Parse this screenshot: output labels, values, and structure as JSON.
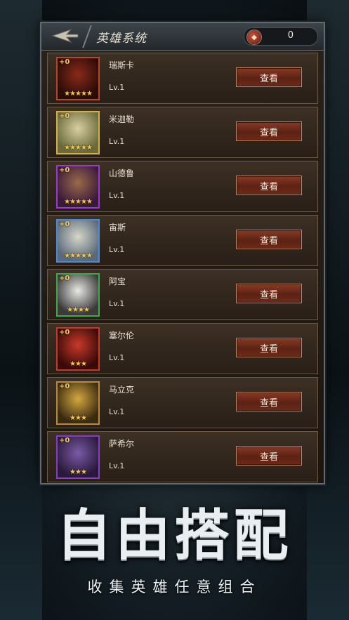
{
  "header": {
    "title": "英雄系统",
    "currency_value": "0"
  },
  "heroes": [
    {
      "name": "瑞斯卡",
      "plus": "+0",
      "level": "Lv.1",
      "stars": "★★★★★",
      "view_label": "查看",
      "border": "#b8452a",
      "face": [
        "#8a2a1a",
        "#2a0c07"
      ]
    },
    {
      "name": "米迦勒",
      "plus": "+0",
      "level": "Lv.1",
      "stars": "★★★★★",
      "view_label": "查看",
      "border": "#d4b04a",
      "face": [
        "#d8cfa2",
        "#6a6a3a"
      ]
    },
    {
      "name": "山德鲁",
      "plus": "+0",
      "level": "Lv.1",
      "stars": "★★★★★",
      "view_label": "查看",
      "border": "#9a3ad0",
      "face": [
        "#9a6a4a",
        "#3a1a3a"
      ]
    },
    {
      "name": "宙斯",
      "plus": "+0",
      "level": "Lv.1",
      "stars": "★★★★★",
      "view_label": "查看",
      "border": "#4a8ad8",
      "face": [
        "#d8d6c8",
        "#5a6a7a"
      ]
    },
    {
      "name": "阿宝",
      "plus": "+0",
      "level": "Lv.1",
      "stars": "★★★★",
      "view_label": "查看",
      "border": "#3aaa4a",
      "face": [
        "#e8e8e4",
        "#3a3a3a"
      ]
    },
    {
      "name": "塞尔伦",
      "plus": "+0",
      "level": "Lv.1",
      "stars": "★★★",
      "view_label": "查看",
      "border": "#c43a2a",
      "face": [
        "#c83a2a",
        "#3a0a08"
      ]
    },
    {
      "name": "马立克",
      "plus": "+0",
      "level": "Lv.1",
      "stars": "★★★",
      "view_label": "查看",
      "border": "#b88a3a",
      "face": [
        "#d4a840",
        "#3a2a10"
      ]
    },
    {
      "name": "萨希尔",
      "plus": "+0",
      "level": "Lv.1",
      "stars": "★★★",
      "view_label": "查看",
      "border": "#8a3ac8",
      "face": [
        "#7a5aa8",
        "#2a1a3a"
      ]
    }
  ],
  "banner": {
    "title": "自由搭配",
    "subtitle": "收集英雄任意组合"
  }
}
